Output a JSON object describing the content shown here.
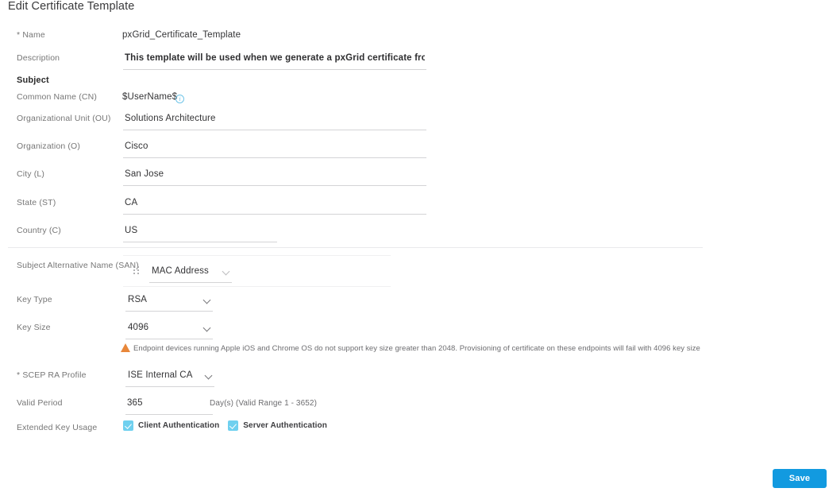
{
  "page": {
    "title": "Edit Certificate Template"
  },
  "form": {
    "name": {
      "label": "Name",
      "value": "pxGrid_Certificate_Template"
    },
    "description": {
      "label": "Description",
      "value": "This template will be used when we generate a pxGrid certificate from the Certif"
    },
    "subject_heading": "Subject",
    "common_name": {
      "label": "Common Name (CN)",
      "value": "$UserName$",
      "info_icon": "info-circle-icon"
    },
    "organizational_unit": {
      "label": "Organizational Unit (OU)",
      "value": "Solutions Architecture"
    },
    "organization": {
      "label": "Organization (O)",
      "value": "Cisco"
    },
    "city": {
      "label": "City (L)",
      "value": "San Jose"
    },
    "state": {
      "label": "State (ST)",
      "value": "CA"
    },
    "country": {
      "label": "Country (C)",
      "value": "US"
    },
    "san": {
      "label": "Subject Alternative Name (SAN)",
      "value": "MAC Address",
      "drag_handle_icon": "drag-handle-icon",
      "chevron_icon": "chevron-down-icon"
    },
    "key_type": {
      "label": "Key Type",
      "value": "RSA",
      "chevron_icon": "chevron-down-icon"
    },
    "key_size": {
      "label": "Key Size",
      "value": "4096",
      "chevron_icon": "chevron-down-icon"
    },
    "key_size_warning": {
      "icon": "warning-triangle-icon",
      "text": "Endpoint devices running Apple iOS and Chrome OS do not support key size greater than 2048. Provisioning of certificate on these endpoints will fail with 4096 key size"
    },
    "scep_ra_profile": {
      "label": "SCEP RA Profile",
      "value": "ISE Internal CA",
      "chevron_icon": "chevron-down-icon"
    },
    "valid_period": {
      "label": "Valid Period",
      "value": "365",
      "suffix": "Day(s) (Valid Range 1 - 3652)"
    },
    "extended_key_usage": {
      "label": "Extended Key Usage",
      "options": [
        {
          "label": "Client Authentication",
          "checked": true
        },
        {
          "label": "Server Authentication",
          "checked": true
        }
      ]
    }
  },
  "footer": {
    "save_label": "Save"
  },
  "colors": {
    "accent_blue": "#129ae0",
    "checkbox_blue": "#6fd0ef",
    "info_blue": "#6fc4e8",
    "warning_orange": "#e8873a",
    "label_gray": "#767676",
    "value_gray": "#333335",
    "line_gray": "#d4d4d6"
  }
}
